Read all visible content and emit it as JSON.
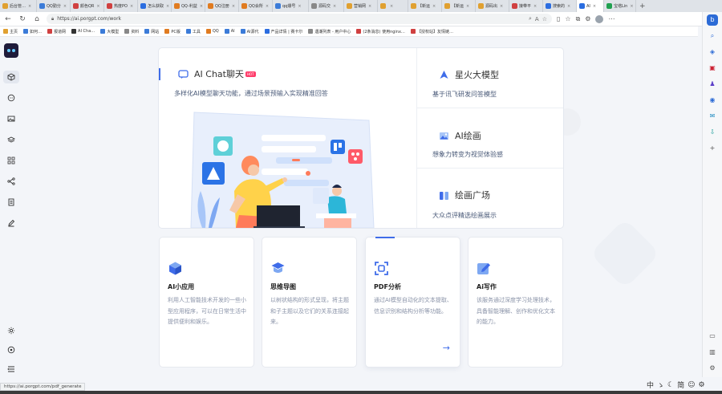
{
  "browser": {
    "tabs": [
      {
        "label": "后台管…",
        "color": "#e0a030"
      },
      {
        "label": "QQ勤分",
        "color": "#3b7bd8"
      },
      {
        "label": "颜色QR",
        "color": "#d04040"
      },
      {
        "label": "热度PO",
        "color": "#d04040"
      },
      {
        "label": "怎么获取",
        "color": "#2b6de0"
      },
      {
        "label": "QQ-利益",
        "color": "#e07b20"
      },
      {
        "label": "QQ注册",
        "color": "#e07b20"
      },
      {
        "label": "QQ会所",
        "color": "#e07b20"
      },
      {
        "label": "qq爆号",
        "color": "#3b7bd8"
      },
      {
        "label": "源码交",
        "color": "#888888"
      },
      {
        "label": "营销网",
        "color": "#e0a030"
      },
      {
        "label": "",
        "color": "#e0a030"
      },
      {
        "label": "【新运",
        "color": "#e0a030"
      },
      {
        "label": "【新运",
        "color": "#e0a030"
      },
      {
        "label": "源码出",
        "color": "#e0a030"
      },
      {
        "label": "接带平",
        "color": "#d04040"
      },
      {
        "label": "搜索的",
        "color": "#2b6de0"
      },
      {
        "label": "AI",
        "color": "#2b6de0",
        "active": true
      },
      {
        "label": "宝塔Lin",
        "color": "#20a050"
      }
    ],
    "url": "https://ai.porgpt.com/work",
    "bookmarks": [
      {
        "label": "主页",
        "color": "#e0a030"
      },
      {
        "label": "如何…",
        "color": "#3b7bd8"
      },
      {
        "label": "报道网",
        "color": "#d04040"
      },
      {
        "label": "AI Cha…",
        "color": "#333333"
      },
      {
        "label": "大模型",
        "color": "#3b7bd8"
      },
      {
        "label": "资料",
        "color": "#888888"
      },
      {
        "label": "网站",
        "color": "#3b7bd8"
      },
      {
        "label": "PC版",
        "color": "#e07b20"
      },
      {
        "label": "工具",
        "color": "#3b7bd8"
      },
      {
        "label": "QQ",
        "color": "#e07b20"
      },
      {
        "label": "AI",
        "color": "#3b7bd8"
      },
      {
        "label": "AI源代",
        "color": "#3b7bd8"
      },
      {
        "label": "产品详情 | 赛卡尔",
        "color": "#2b6de0"
      },
      {
        "label": "遇潮列表 - 用户中心",
        "color": "#888888"
      },
      {
        "label": "(2条消息) 使用nginx…",
        "color": "#d04040"
      },
      {
        "label": "【授权站】友情链…",
        "color": "#d04040"
      }
    ],
    "status_url": "https://ai.porgpt.com/pdf_generate",
    "ime": [
      "中",
      "ゝ",
      "简"
    ]
  },
  "hero": {
    "main_title": "AI Chat聊天",
    "hot_badge": "HOT",
    "main_desc": "多样化AI模型聊天功能，通过场景预输入实现精准回答",
    "features": [
      {
        "title": "星火大模型",
        "desc": "基于讯飞研发问答模型",
        "icon": "spark-icon"
      },
      {
        "title": "AI绘画",
        "desc": "想象力转变为视觉体验感",
        "icon": "image-icon"
      },
      {
        "title": "绘画广场",
        "desc": "大众点评精选绘画展示",
        "icon": "gallery-icon"
      }
    ]
  },
  "cards": [
    {
      "title": "AI小应用",
      "desc": "利用人工智能技术开发的一些小型应用程序，可以在日常生活中提供便利和娱乐。",
      "icon": "cube-icon"
    },
    {
      "title": "思维导图",
      "desc": "以树状结构的形式呈现，将主题和子主题以及它们的关系连接起来。",
      "icon": "mindmap-icon"
    },
    {
      "title": "PDF分析",
      "desc": "通过AI模型自动化的文本提取、信息识别和结构分析等功能。",
      "icon": "scan-icon"
    },
    {
      "title": "Ai写作",
      "desc": "该服务通过深度学习处理技术，具备智能理解、创作和优化文本的能力。",
      "icon": "pen-icon"
    }
  ],
  "colors": {
    "accent": "#3f6ce9",
    "hot": "#ff3d6b"
  }
}
